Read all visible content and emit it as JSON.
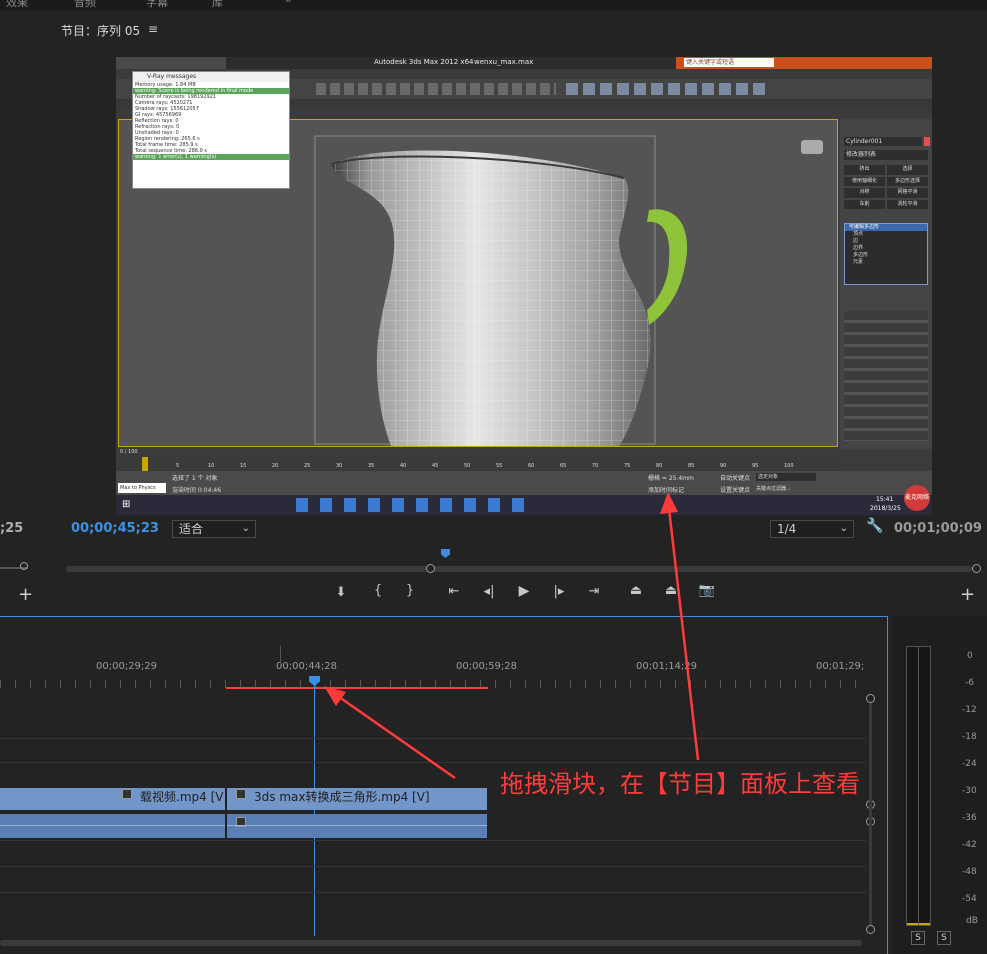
{
  "top_tabs": [
    "效果",
    "音频",
    "字幕",
    "库"
  ],
  "source_panel": {
    "timecode_fragment": ";25"
  },
  "program": {
    "title": "节目：序列 05",
    "timecode_current": "00;00;45;23",
    "fit_label": "适合",
    "resolution_label": "1/4",
    "timecode_end": "00;01;00;09"
  },
  "screen": {
    "app_title": "Autodesk 3ds Max  2012 x64",
    "file_name": "wenxu_max.max",
    "search_hint": "键入关键字或短语",
    "object_name": "Cylinder001",
    "modifier_list": "修改器列表",
    "modifier_buttons": [
      "挤出",
      "选择",
      "使用轴细化",
      "多边形选择",
      "对称",
      "网格平滑",
      "车削",
      "涡轮平滑"
    ],
    "stack_items": [
      "可编辑多边形",
      "顶点",
      "边",
      "边界",
      "多边形",
      "元素"
    ],
    "vray": {
      "title": "V-Ray messages",
      "lines": [
        "Memory usage: 1.84 MB",
        "warning: Scene is being rendered in final mode",
        "Number of raycasts: 198192921",
        "Camera rays: 4520271",
        "Shadow rays: 155612057",
        "GI rays: 45756969",
        "Reflection rays: 0",
        "Refraction rays: 0",
        "Unshaded rays: 0",
        "Region rendering: 265.6 s",
        "Total frame time: 285.9 s",
        "Total sequence time: 286.0 s",
        "warning: 1 error(s), 1 warning(s)"
      ]
    },
    "frame_counter": "0 / 100",
    "status_selected": "选择了 1 个 对象",
    "render_time": "渲染时间 0:04:46",
    "grid_text": "栅格 = 25.4mm",
    "add_time_tag": "添加时间标记",
    "auto_key": "自动关键点",
    "set_key": "设置关键点",
    "selected_label": "选定对象",
    "key_filters": "关键点过滤器...",
    "maxscript_label": "Max to Physcs",
    "clock_time": "15:41",
    "clock_date": "2018/3/25",
    "watermark": "麦克网络",
    "ruler_ticks": [
      "5",
      "10",
      "15",
      "20",
      "25",
      "30",
      "35",
      "40",
      "45",
      "50",
      "55",
      "60",
      "65",
      "70",
      "75",
      "80",
      "85",
      "90",
      "95",
      "100"
    ]
  },
  "timeline": {
    "ruler_labels": [
      "00;00;29;29",
      "00;00;44;28",
      "00;00;59;28",
      "00;01;14;29",
      "00;01;29;"
    ],
    "clip1_label": "载视频.mp4 [V]",
    "clip2_label": "3ds max转换成三角形.mp4 [V]"
  },
  "annotation": "拖拽滑块，在【节目】面板上查看",
  "meter": {
    "db_labels": [
      "0",
      "-6",
      "-12",
      "-18",
      "-24",
      "-30",
      "-36",
      "-42",
      "-48",
      "-54",
      "dB"
    ],
    "solo_labels": [
      "S",
      "S"
    ]
  },
  "colors": {
    "accent_blue": "#3a94e6",
    "annotation_red": "#ff3b3b",
    "clip_video": "#7396c9",
    "jug_handle": "#8fc43a"
  }
}
